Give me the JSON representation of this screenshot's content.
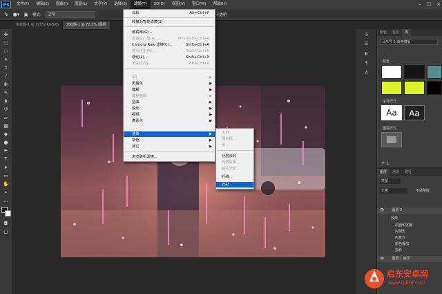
{
  "menubar": {
    "logo": "Ps",
    "items": [
      "文件(F)",
      "编辑(E)",
      "图像(I)",
      "图层(L)",
      "文字(Y)",
      "选择(S)",
      "滤镜(T)",
      "3D(D)",
      "视图(V)",
      "窗口(W)",
      "帮助(H)"
    ],
    "active_index": 6
  },
  "optionsbar": {
    "mode_label": "模式:",
    "mode_value": "正常",
    "opacity_label": "不透明"
  },
  "tabs": [
    "未标题-1 @ 100%(RGB/8)",
    "未标题-1 @ 72.1% (图层"
  ],
  "filter_menu": {
    "items": [
      {
        "label": "云彩",
        "shortcut": "Alt+Ctrl+F",
        "disabled": false
      },
      {
        "label": "转换为智能滤镜(S)",
        "shortcut": "",
        "disabled": false
      },
      {
        "label": "滤镜库(G)...",
        "shortcut": "",
        "disabled": false
      },
      {
        "label": "自适应广角(A)...",
        "shortcut": "Alt+Shift+Ctrl+A",
        "disabled": true
      },
      {
        "label": "Camera Raw 滤镜(C)...",
        "shortcut": "Shift+Ctrl+A",
        "disabled": false
      },
      {
        "label": "镜头校正(R)...",
        "shortcut": "Shift+Ctrl+R",
        "disabled": true
      },
      {
        "label": "液化(L)...",
        "shortcut": "Shift+Ctrl+X",
        "disabled": false
      },
      {
        "label": "消失点(V)...",
        "shortcut": "Alt+Ctrl+V",
        "disabled": true
      },
      {
        "label": "3D",
        "shortcut": "",
        "disabled": true,
        "sub": true
      },
      {
        "label": "风格化",
        "shortcut": "",
        "disabled": false,
        "sub": true
      },
      {
        "label": "模糊",
        "shortcut": "",
        "disabled": false,
        "sub": true
      },
      {
        "label": "模糊画廊",
        "shortcut": "",
        "disabled": true,
        "sub": true
      },
      {
        "label": "扭曲",
        "shortcut": "",
        "disabled": false,
        "sub": true
      },
      {
        "label": "锐化",
        "shortcut": "",
        "disabled": false,
        "sub": true
      },
      {
        "label": "视频",
        "shortcut": "",
        "disabled": false,
        "sub": true
      },
      {
        "label": "像素化",
        "shortcut": "",
        "disabled": false,
        "sub": true
      },
      {
        "label": "渲染",
        "shortcut": "",
        "disabled": false,
        "sub": true,
        "highlight": true
      },
      {
        "label": "杂色",
        "shortcut": "",
        "disabled": false,
        "sub": true
      },
      {
        "label": "其它",
        "shortcut": "",
        "disabled": false,
        "sub": true
      },
      {
        "label": "浏览联机滤镜...",
        "shortcut": "",
        "disabled": false
      }
    ]
  },
  "render_submenu": {
    "items": [
      {
        "label": "火焰...",
        "disabled": true
      },
      {
        "label": "图片框...",
        "disabled": true
      },
      {
        "label": "树...",
        "disabled": true
      },
      {
        "label": "分层云彩",
        "disabled": false
      },
      {
        "label": "光照效果...",
        "disabled": true
      },
      {
        "label": "镜头光晕...",
        "disabled": true
      },
      {
        "label": "纤维...",
        "disabled": false
      },
      {
        "label": "云彩",
        "disabled": false,
        "highlight": true
      }
    ]
  },
  "right_panels": {
    "tabs": [
      "颜色",
      "色板",
      "库"
    ],
    "library_name": "公众号 3:商用模版",
    "section_colors": "颜色",
    "swatches": [
      "#ffffff",
      "#141414",
      "#5b8a8f",
      "#d9f42a",
      "#d9f42a",
      "#000000"
    ],
    "section_styles": "字符样式",
    "style_sample": "Aa",
    "section_graphics": "图层样式",
    "layers_tabs": [
      "图层",
      "通道",
      "路径"
    ],
    "layers_kind": "类型",
    "blend_mode": "正常",
    "opacity_label": "不透明度:",
    "layer_rows": [
      "图层 2",
      "效果",
      "斜面和浮雕",
      "内阴影",
      "内发光",
      "颜色叠加",
      "投影",
      "图层 1 拷贝"
    ]
  },
  "watermark": {
    "site_name": "启东安卓网",
    "url": "www.qdltd.com"
  },
  "colors": {
    "accent": "#0a64d6",
    "ui_bg": "#282828"
  }
}
